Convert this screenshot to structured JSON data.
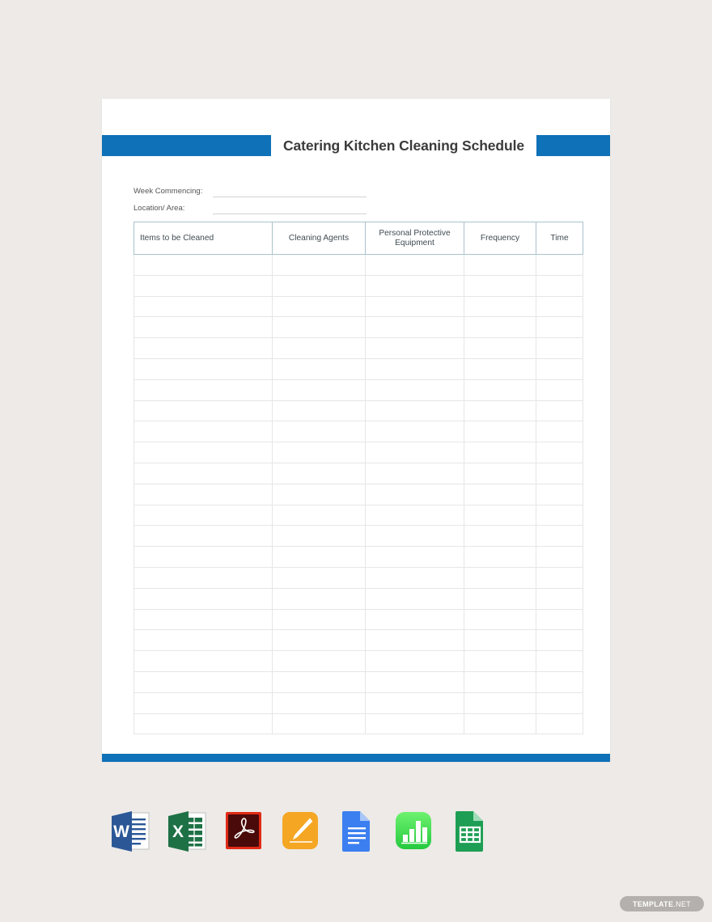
{
  "document": {
    "title": "Catering Kitchen Cleaning Schedule",
    "accent_color": "#0f71b8",
    "title_color": "#3b3b3b",
    "page_background": "#ffffff",
    "canvas_background": "#edeae7"
  },
  "meta_fields": [
    {
      "label": "Week Commencing:",
      "value": ""
    },
    {
      "label": "Location/ Area:",
      "value": ""
    }
  ],
  "table": {
    "columns": [
      {
        "key": "items",
        "label": "Items to be Cleaned"
      },
      {
        "key": "agents",
        "label": "Cleaning Agents"
      },
      {
        "key": "ppe",
        "label": "Personal Protective Equipment"
      },
      {
        "key": "freq",
        "label": "Frequency"
      },
      {
        "key": "time",
        "label": "Time"
      }
    ],
    "row_count": 23,
    "rows": [],
    "header_border_color": "#a9c3cc",
    "body_border_color": "#e6e6e6"
  },
  "format_icons": [
    {
      "name": "word-icon",
      "label": "Word",
      "color": "#2b5797"
    },
    {
      "name": "excel-icon",
      "label": "Excel",
      "color": "#1e7145"
    },
    {
      "name": "pdf-icon",
      "label": "PDF",
      "color": "#5c0f0f"
    },
    {
      "name": "apple-pages-icon",
      "label": "Apple Pages",
      "color": "#f5a623"
    },
    {
      "name": "google-docs-icon",
      "label": "Google Docs",
      "color": "#3b7ff0"
    },
    {
      "name": "apple-numbers-icon",
      "label": "Apple Numbers",
      "color": "#4ce05a"
    },
    {
      "name": "google-sheets-icon",
      "label": "Google Sheets",
      "color": "#1e9e54"
    }
  ],
  "watermark": {
    "text_bold": "TEMPLATE",
    "text_light": ".NET",
    "background": "#b3b0ad"
  }
}
